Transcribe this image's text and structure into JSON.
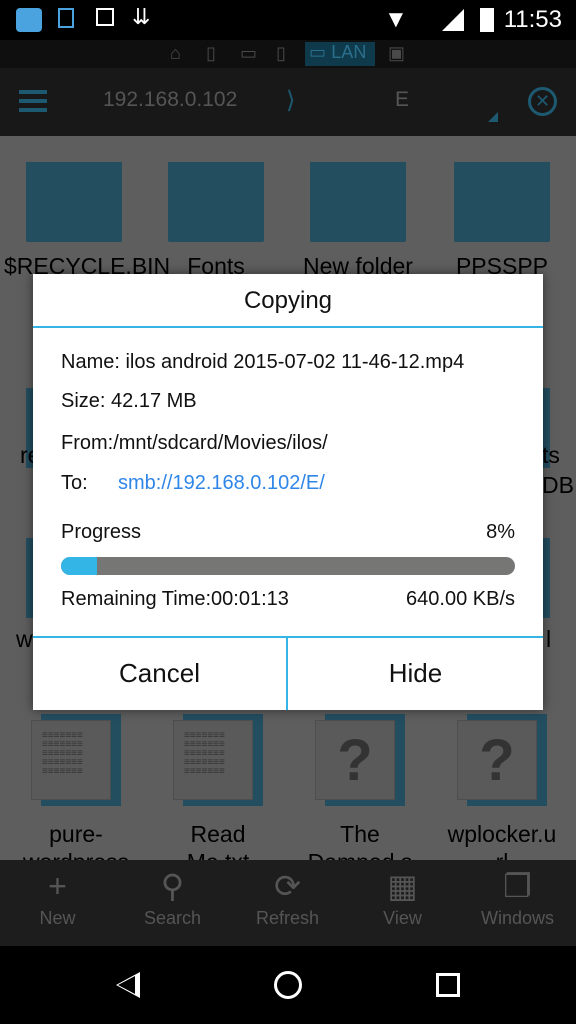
{
  "status_bar": {
    "time": "11:53",
    "icons": [
      "es-file-explorer-icon",
      "copy-notification-icon",
      "image-icon",
      "download-icon",
      "wifi-icon",
      "signal-icon",
      "battery-icon"
    ]
  },
  "location_tabs": {
    "items": [
      "home-icon",
      "phone-icon",
      "computer-icon",
      "phone-icon",
      "computer-icon",
      "multi-device-icon"
    ],
    "active_label": "LAN"
  },
  "header": {
    "breadcrumb": [
      "192.168.0.102",
      "E"
    ]
  },
  "files": {
    "row1": [
      "$RECYCLE.BIN",
      "Fonts",
      "New folder",
      "PPSSPP"
    ],
    "row2_fragments": {
      "left": "re",
      "right": "ts",
      "right2": "DB"
    },
    "row3_fragments": {
      "left": "w",
      "right": "l"
    },
    "row4": [
      {
        "line1": "pure-",
        "line2": "wordpress",
        "type": "text"
      },
      {
        "line1": "Read",
        "line2": "Me.txt",
        "type": "text"
      },
      {
        "line1": "The",
        "line2": "Damned.s",
        "type": "unknown"
      },
      {
        "line1": "wplocker.u",
        "line2": "rl",
        "type": "unknown"
      }
    ]
  },
  "dialog": {
    "title": "Copying",
    "name": "Name: ilos android 2015-07-02 11-46-12.mp4",
    "size": "Size: 42.17 MB",
    "from": "From:/mnt/sdcard/Movies/ilos/",
    "to_label": "To:",
    "to_value": "smb://192.168.0.102/E/",
    "progress_label": "Progress",
    "progress_text": "8%",
    "progress": 8,
    "remaining": "Remaining Time:00:01:13",
    "speed": "640.00 KB/s",
    "cancel": "Cancel",
    "hide": "Hide",
    "accent": "#33b5e5",
    "link_color": "#2f86e8"
  },
  "toolbar": [
    {
      "label": "New",
      "icon": "plus-icon"
    },
    {
      "label": "Search",
      "icon": "search-icon"
    },
    {
      "label": "Refresh",
      "icon": "refresh-icon"
    },
    {
      "label": "View",
      "icon": "grid-icon"
    },
    {
      "label": "Windows",
      "icon": "windows-icon"
    }
  ]
}
